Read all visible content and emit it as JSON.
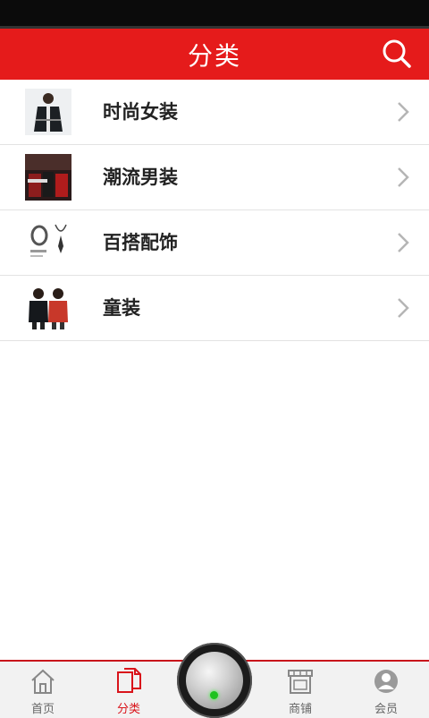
{
  "header": {
    "title": "分类"
  },
  "categories": [
    {
      "label": "时尚女装"
    },
    {
      "label": "潮流男装"
    },
    {
      "label": "百搭配饰"
    },
    {
      "label": "童装"
    }
  ],
  "tabbar": {
    "items": [
      {
        "label": "首页",
        "icon": "home-icon"
      },
      {
        "label": "分类",
        "icon": "category-icon",
        "active": true
      },
      {
        "label": "",
        "icon": "center-knob"
      },
      {
        "label": "商铺",
        "icon": "shop-icon"
      },
      {
        "label": "会员",
        "icon": "member-icon"
      }
    ]
  },
  "colors": {
    "header_bg": "#e51b1b",
    "tab_active": "#d9141b"
  }
}
